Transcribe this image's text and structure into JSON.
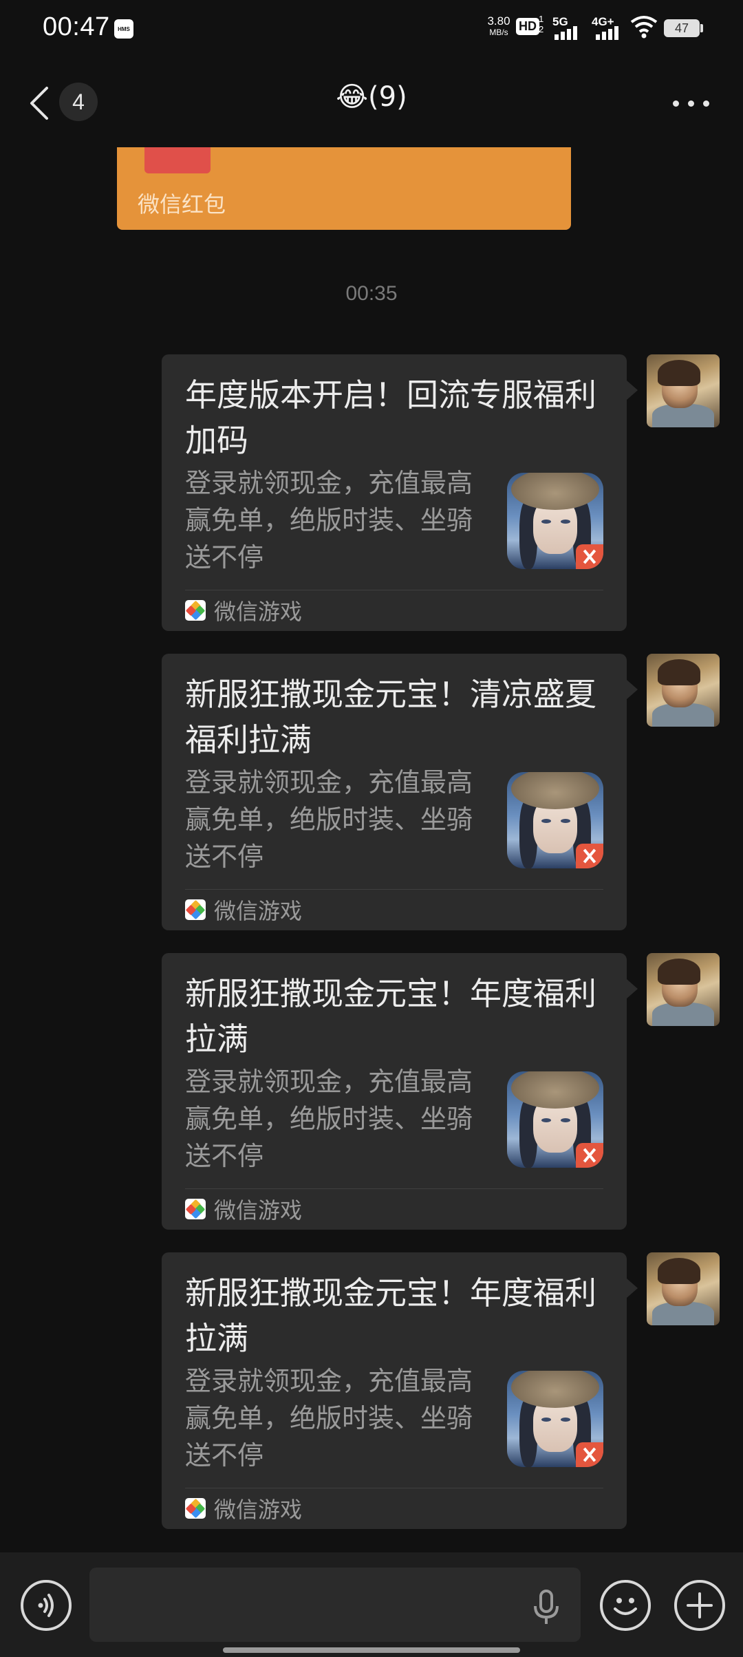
{
  "status_bar": {
    "time": "00:47",
    "hms_label": "HMS",
    "speed_value": "3.80",
    "speed_unit": "MB/s",
    "hd_label": "HD",
    "hd_sub1": "1",
    "hd_sub2": "2",
    "net_5g": "5G",
    "net_4g": "4G+",
    "battery": "47"
  },
  "header": {
    "unread_count": "4",
    "title": "😂(9)"
  },
  "red_packet": {
    "label": "微信红包"
  },
  "time_divider": "00:35",
  "messages": [
    {
      "title": "年度版本开启！回流专服福利加码",
      "description": "登录就领现金，充值最高赢免单，绝版时装、坐骑送不停",
      "source": "微信游戏"
    },
    {
      "title": "新服狂撒现金元宝！清凉盛夏福利拉满",
      "description": "登录就领现金，充值最高赢免单，绝版时装、坐骑送不停",
      "source": "微信游戏"
    },
    {
      "title": "新服狂撒现金元宝！年度福利拉满",
      "description": "登录就领现金，充值最高赢免单，绝版时装、坐骑送不停",
      "source": "微信游戏"
    },
    {
      "title": "新服狂撒现金元宝！年度福利拉满",
      "description": "登录就领现金，充值最高赢免单，绝版时装、坐骑送不停",
      "source": "微信游戏"
    }
  ],
  "icons": {
    "back": "chevron-left-icon",
    "more": "more-dots-icon",
    "voice": "voice-toggle-icon",
    "mic": "microphone-icon",
    "emoji": "smiley-icon",
    "plus": "plus-icon"
  },
  "colors": {
    "background": "#111111",
    "bubble": "#2c2c2c",
    "red_packet": "#e5933a",
    "input_bar": "#1e1e1e"
  }
}
